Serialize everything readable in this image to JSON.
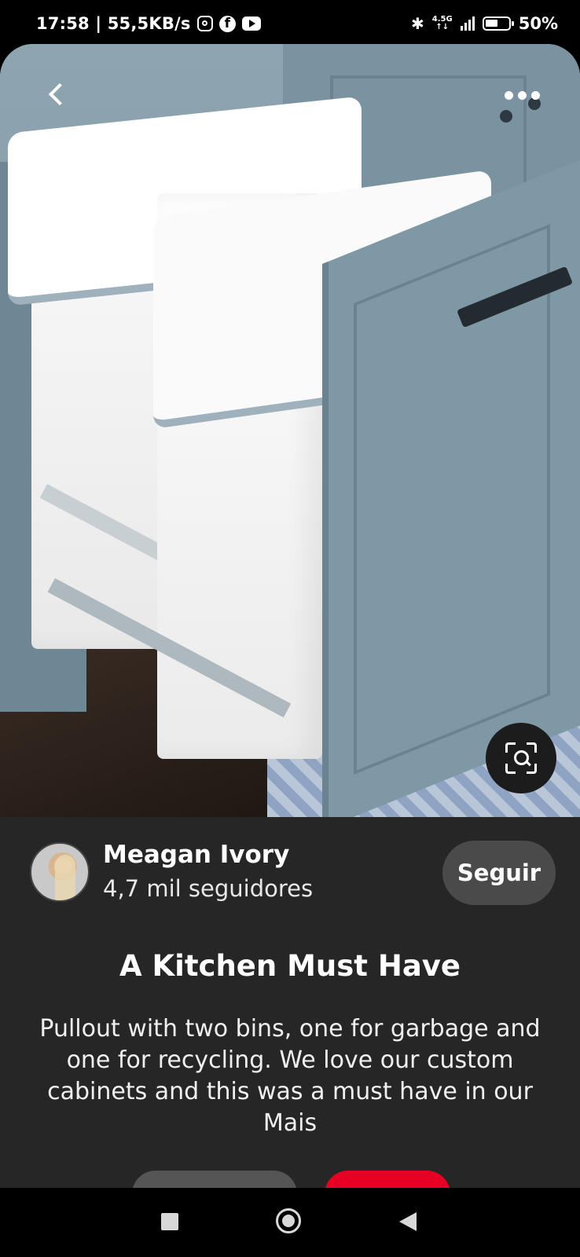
{
  "status_bar": {
    "time_speed": "17:58 | 55,5KB/s",
    "network_type": "4.5G",
    "battery": "50%",
    "icons": [
      "instagram-icon",
      "facebook-icon",
      "youtube-icon",
      "bluetooth-icon",
      "signal-icon",
      "battery-icon"
    ]
  },
  "pin": {
    "image_alt": "Pullout cabinet with two white bins",
    "creator": {
      "name": "Meagan Ivory",
      "followers": "4,7 mil seguidores"
    },
    "follow_label": "Seguir",
    "title": "A Kitchen Must Have",
    "description": "Pullout with two bins, one for garbage and one for recycling. We love our custom cabinets and this was a must have in our",
    "more_label": "Mais"
  },
  "colors": {
    "panel_bg": "#262626",
    "follow_bg": "#4a4a4a",
    "save_red": "#e60023"
  }
}
